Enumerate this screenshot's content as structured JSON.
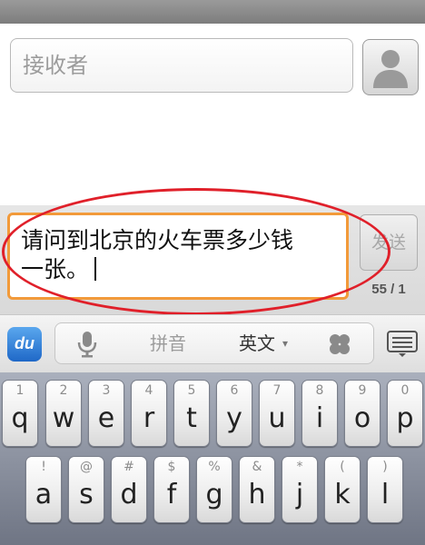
{
  "recipient": {
    "placeholder": "接收者"
  },
  "compose": {
    "message_line1": "请问到北京的火车票多少钱",
    "message_line2": "一张。",
    "send_label": "发送",
    "char_counter": "55 / 1"
  },
  "ime": {
    "logo_label": "du",
    "pinyin_label": "拼音",
    "english_label": "英文",
    "english_caret": "▾"
  },
  "keyboard": {
    "row1": [
      {
        "sub": "1",
        "main": "q"
      },
      {
        "sub": "2",
        "main": "w"
      },
      {
        "sub": "3",
        "main": "e"
      },
      {
        "sub": "4",
        "main": "r"
      },
      {
        "sub": "5",
        "main": "t"
      },
      {
        "sub": "6",
        "main": "y"
      },
      {
        "sub": "7",
        "main": "u"
      },
      {
        "sub": "8",
        "main": "i"
      },
      {
        "sub": "9",
        "main": "o"
      },
      {
        "sub": "0",
        "main": "p"
      }
    ],
    "row2": [
      {
        "sub": "!",
        "main": "a"
      },
      {
        "sub": "@",
        "main": "s"
      },
      {
        "sub": "#",
        "main": "d"
      },
      {
        "sub": "$",
        "main": "f"
      },
      {
        "sub": "%",
        "main": "g"
      },
      {
        "sub": "&",
        "main": "h"
      },
      {
        "sub": "*",
        "main": "j"
      },
      {
        "sub": "(",
        "main": "k"
      },
      {
        "sub": ")",
        "main": "l"
      }
    ]
  },
  "icons": {
    "contact": "contact-person-icon",
    "mic": "microphone-icon",
    "clover": "clover-icon",
    "menu": "keyboard-menu-icon"
  },
  "colors": {
    "focus_border": "#f29a3a",
    "highlight_oval": "#e0202a",
    "ime_logo": "#1f68c7"
  }
}
